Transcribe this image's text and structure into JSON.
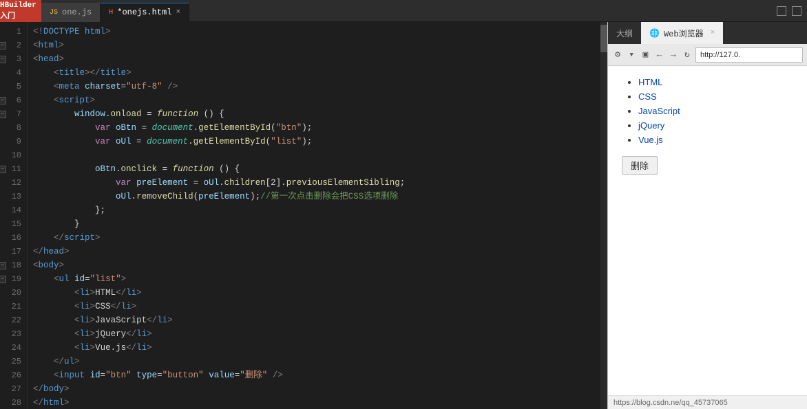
{
  "titlebar": {
    "logo": "HBuilder入门",
    "tabs": [
      {
        "id": "tab-one-js",
        "label": "one.js",
        "active": false,
        "closable": false,
        "icon": "js"
      },
      {
        "id": "tab-onejs-html",
        "label": "*onejs.html",
        "active": true,
        "closable": true,
        "icon": "html"
      }
    ],
    "outline_label": "大纲"
  },
  "editor": {
    "lines": [
      {
        "num": "1",
        "fold": false,
        "content_html": "<span class='c-bracket'>&lt;!</span><span class='c-tag'>DOCTYPE html</span><span class='c-bracket'>&gt;</span>"
      },
      {
        "num": "2",
        "fold": true,
        "content_html": "<span class='c-bracket'>&lt;</span><span class='c-tag'>html</span><span class='c-bracket'>&gt;</span>"
      },
      {
        "num": "3",
        "fold": true,
        "content_html": "<span class='c-bracket'>&lt;</span><span class='c-tag'>head</span><span class='c-bracket'>&gt;</span>"
      },
      {
        "num": "4",
        "fold": false,
        "content_html": "    <span class='c-bracket'>&lt;</span><span class='c-tag'>title</span><span class='c-bracket'>&gt;&lt;/</span><span class='c-tag'>title</span><span class='c-bracket'>&gt;</span>"
      },
      {
        "num": "5",
        "fold": false,
        "content_html": "    <span class='c-bracket'>&lt;</span><span class='c-tag'>meta</span> <span class='c-attr'>charset</span><span class='c-punct'>=</span><span class='c-val'>\"utf-8\"</span> <span class='c-bracket'>/&gt;</span>"
      },
      {
        "num": "6",
        "fold": true,
        "content_html": "    <span class='c-bracket'>&lt;</span><span class='c-tag'>script</span><span class='c-bracket'>&gt;</span>"
      },
      {
        "num": "7",
        "fold": true,
        "content_html": "        <span class='c-var'>window</span><span class='c-punct'>.</span><span class='c-method'>onload</span> <span class='c-punct'>=</span> <span class='c-func'>function</span> <span class='c-punct'>() {</span>"
      },
      {
        "num": "8",
        "fold": false,
        "content_html": "            <span class='c-keyword'>var</span> <span class='c-var'>oBtn</span> <span class='c-punct'>=</span> <span class='c-obj'>document</span><span class='c-punct'>.</span><span class='c-method'>getElementById</span><span class='c-punct'>(</span><span class='c-str'>\"btn\"</span><span class='c-punct'>);</span>"
      },
      {
        "num": "9",
        "fold": false,
        "content_html": "            <span class='c-keyword'>var</span> <span class='c-var'>oUl</span> <span class='c-punct'>=</span> <span class='c-obj'>document</span><span class='c-punct'>.</span><span class='c-method'>getElementById</span><span class='c-punct'>(</span><span class='c-str'>\"list\"</span><span class='c-punct'>);</span>"
      },
      {
        "num": "10",
        "fold": false,
        "content_html": ""
      },
      {
        "num": "11",
        "fold": true,
        "content_html": "            <span class='c-var'>oBtn</span><span class='c-punct'>.</span><span class='c-method'>onclick</span> <span class='c-punct'>=</span> <span class='c-func'>function</span> <span class='c-punct'>() {</span>"
      },
      {
        "num": "12",
        "fold": false,
        "content_html": "                <span class='c-keyword'>var</span> <span class='c-var'>preElement</span> <span class='c-punct'>=</span> <span class='c-var'>oUl</span><span class='c-punct'>.</span><span class='c-method'>children</span><span class='c-punct'>[2].</span><span class='c-method'>previousElementSibling</span><span class='c-punct'>;</span>"
      },
      {
        "num": "13",
        "fold": false,
        "content_html": "                <span class='c-var'>oUl</span><span class='c-punct'>.</span><span class='c-method'>removeChild</span><span class='c-punct'>(</span><span class='c-var'>preElement</span><span class='c-punct'>);</span><span class='c-comment'>//第一次点击删除会把CSS选项删除</span>"
      },
      {
        "num": "14",
        "fold": false,
        "content_html": "            <span class='c-punct'>};</span>"
      },
      {
        "num": "15",
        "fold": false,
        "content_html": "        <span class='c-punct'>}</span>"
      },
      {
        "num": "16",
        "fold": false,
        "content_html": "    <span class='c-bracket'>&lt;/</span><span class='c-tag'>script</span><span class='c-bracket'>&gt;</span>"
      },
      {
        "num": "17",
        "fold": false,
        "content_html": "<span class='c-bracket'>&lt;/</span><span class='c-tag'>head</span><span class='c-bracket'>&gt;</span>"
      },
      {
        "num": "18",
        "fold": true,
        "content_html": "<span class='c-bracket'>&lt;</span><span class='c-tag'>body</span><span class='c-bracket'>&gt;</span>"
      },
      {
        "num": "19",
        "fold": true,
        "content_html": "    <span class='c-bracket'>&lt;</span><span class='c-tag'>ul</span> <span class='c-attr'>id</span><span class='c-punct'>=</span><span class='c-val'>\"list\"</span><span class='c-bracket'>&gt;</span>"
      },
      {
        "num": "20",
        "fold": false,
        "content_html": "        <span class='c-bracket'>&lt;</span><span class='c-tag'>li</span><span class='c-bracket'>&gt;</span><span class='c-white'>HTML</span><span class='c-bracket'>&lt;/</span><span class='c-tag'>li</span><span class='c-bracket'>&gt;</span>"
      },
      {
        "num": "21",
        "fold": false,
        "content_html": "        <span class='c-bracket'>&lt;</span><span class='c-tag'>li</span><span class='c-bracket'>&gt;</span><span class='c-white'>CSS</span><span class='c-bracket'>&lt;/</span><span class='c-tag'>li</span><span class='c-bracket'>&gt;</span>"
      },
      {
        "num": "22",
        "fold": false,
        "content_html": "        <span class='c-bracket'>&lt;</span><span class='c-tag'>li</span><span class='c-bracket'>&gt;</span><span class='c-white'>JavaScript</span><span class='c-bracket'>&lt;/</span><span class='c-tag'>li</span><span class='c-bracket'>&gt;</span>"
      },
      {
        "num": "23",
        "fold": false,
        "content_html": "        <span class='c-bracket'>&lt;</span><span class='c-tag'>li</span><span class='c-bracket'>&gt;</span><span class='c-white'>jQuery</span><span class='c-bracket'>&lt;/</span><span class='c-tag'>li</span><span class='c-bracket'>&gt;</span>"
      },
      {
        "num": "24",
        "fold": false,
        "content_html": "        <span class='c-bracket'>&lt;</span><span class='c-tag'>li</span><span class='c-bracket'>&gt;</span><span class='c-white'>Vue.js</span><span class='c-bracket'>&lt;/</span><span class='c-tag'>li</span><span class='c-bracket'>&gt;</span>"
      },
      {
        "num": "25",
        "fold": false,
        "content_html": "    <span class='c-bracket'>&lt;/</span><span class='c-tag'>ul</span><span class='c-bracket'>&gt;</span>"
      },
      {
        "num": "26",
        "fold": false,
        "content_html": "    <span class='c-bracket'>&lt;</span><span class='c-tag'>input</span> <span class='c-attr'>id</span><span class='c-punct'>=</span><span class='c-val'>\"btn\"</span> <span class='c-attr'>type</span><span class='c-punct'>=</span><span class='c-val'>\"button\"</span> <span class='c-attr'>value</span><span class='c-punct'>=</span><span class='c-val'>\"删除\"</span> <span class='c-bracket'>/&gt;</span>"
      },
      {
        "num": "27",
        "fold": false,
        "content_html": "<span class='c-bracket'>&lt;/</span><span class='c-tag'>body</span><span class='c-bracket'>&gt;</span>"
      },
      {
        "num": "28",
        "fold": false,
        "content_html": "<span class='c-bracket'>&lt;/</span><span class='c-tag'>html</span><span class='c-bracket'>&gt;</span>"
      }
    ]
  },
  "right_panel": {
    "outline_tab": "大纲",
    "browser_tab": "Web浏览器",
    "url": "http://127.0.",
    "browser_items": [
      "HTML",
      "CSS",
      "JavaScript",
      "jQuery",
      "Vue.js"
    ],
    "delete_button": "删除",
    "status_text": "https://blog.csdn.ne/qq_45737065"
  }
}
